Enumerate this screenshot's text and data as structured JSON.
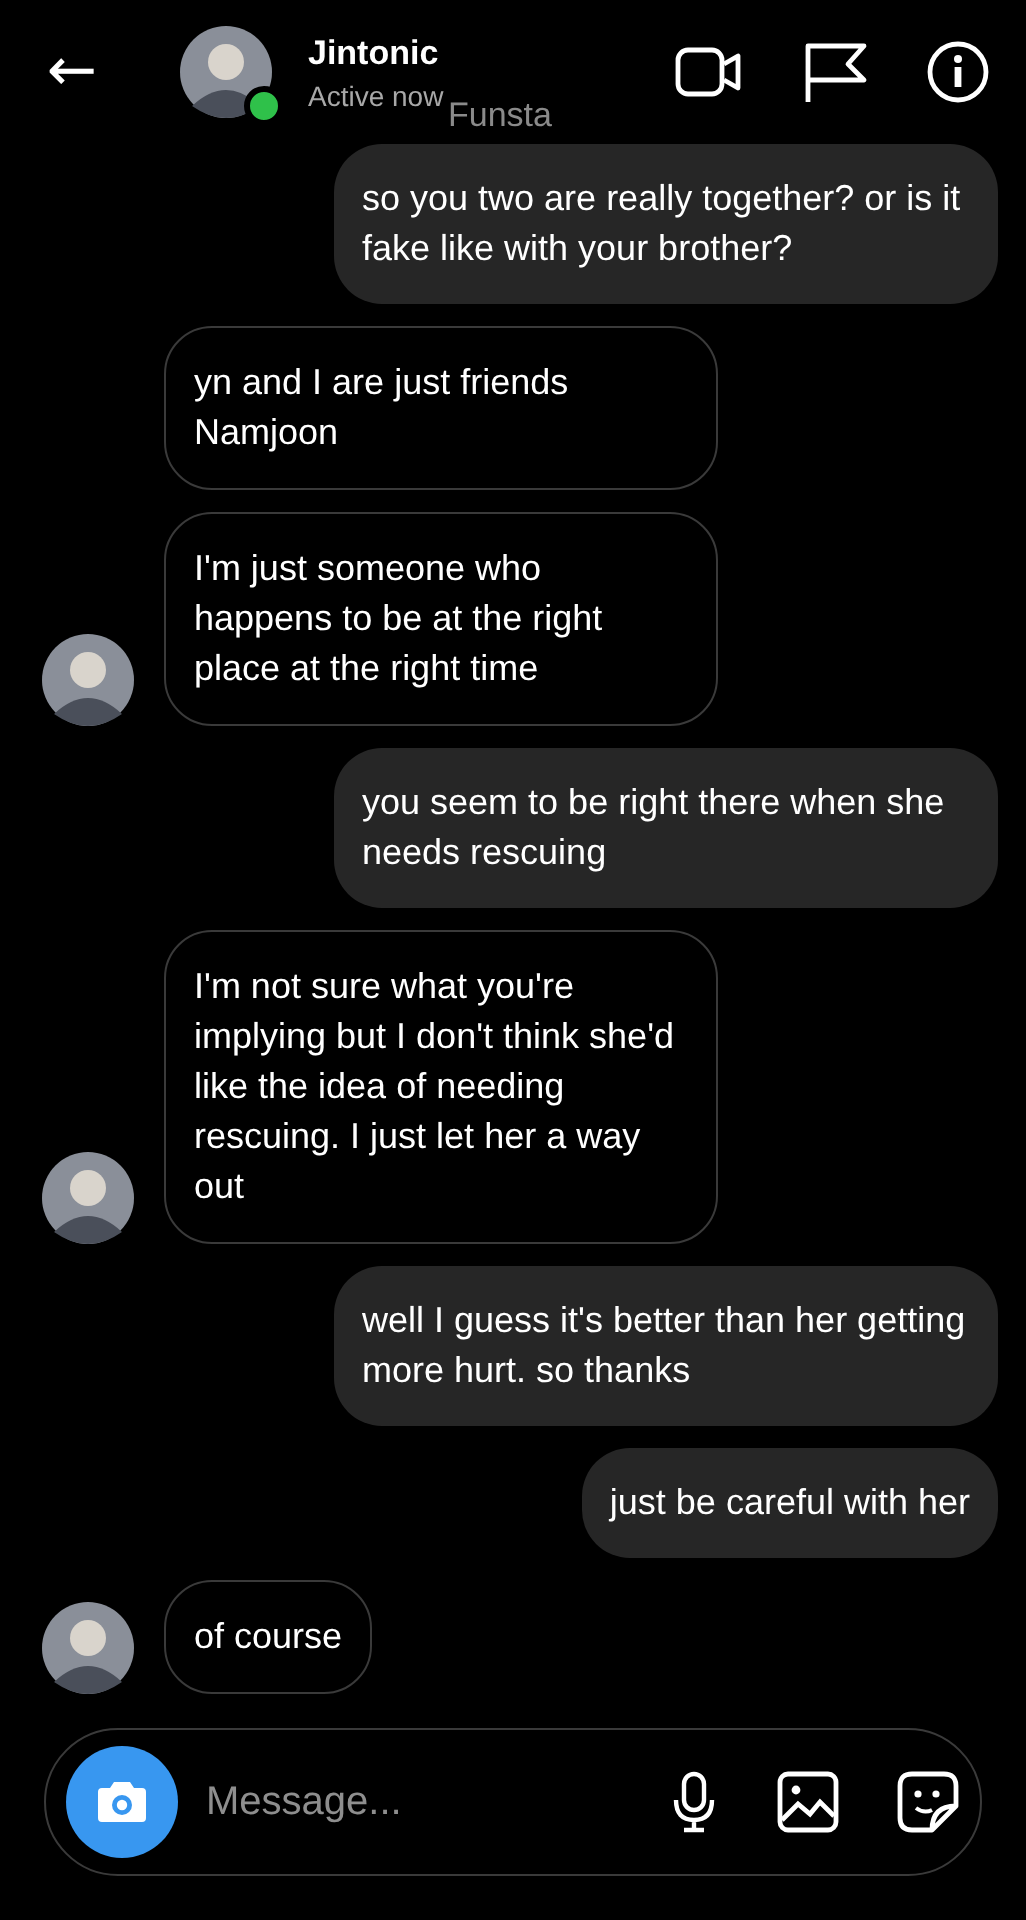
{
  "header": {
    "back": "←",
    "name": "Jintonic",
    "status": "Active now",
    "online": true
  },
  "overlay_label": "Funsta",
  "messages": [
    {
      "kind": "sent",
      "text": "so you two are really together? or is it fake like with your brother?"
    },
    {
      "kind": "received",
      "text": "yn and I are just friends Namjoon",
      "show_avatar": false
    },
    {
      "kind": "received",
      "text": "I'm just someone who happens to be at the right place at the right time",
      "show_avatar": true
    },
    {
      "kind": "sent",
      "text": "you seem to be right there when she needs rescuing"
    },
    {
      "kind": "received",
      "text": "I'm not sure what you're implying but I don't think she'd like the idea of needing rescuing. I just let her a way out",
      "show_avatar": true
    },
    {
      "kind": "sent",
      "text": "well I guess it's better than her getting more hurt. so thanks"
    },
    {
      "kind": "sent",
      "text": "just be careful with her"
    },
    {
      "kind": "received",
      "text": "of course",
      "show_avatar": true
    }
  ],
  "composer": {
    "placeholder": "Message..."
  }
}
